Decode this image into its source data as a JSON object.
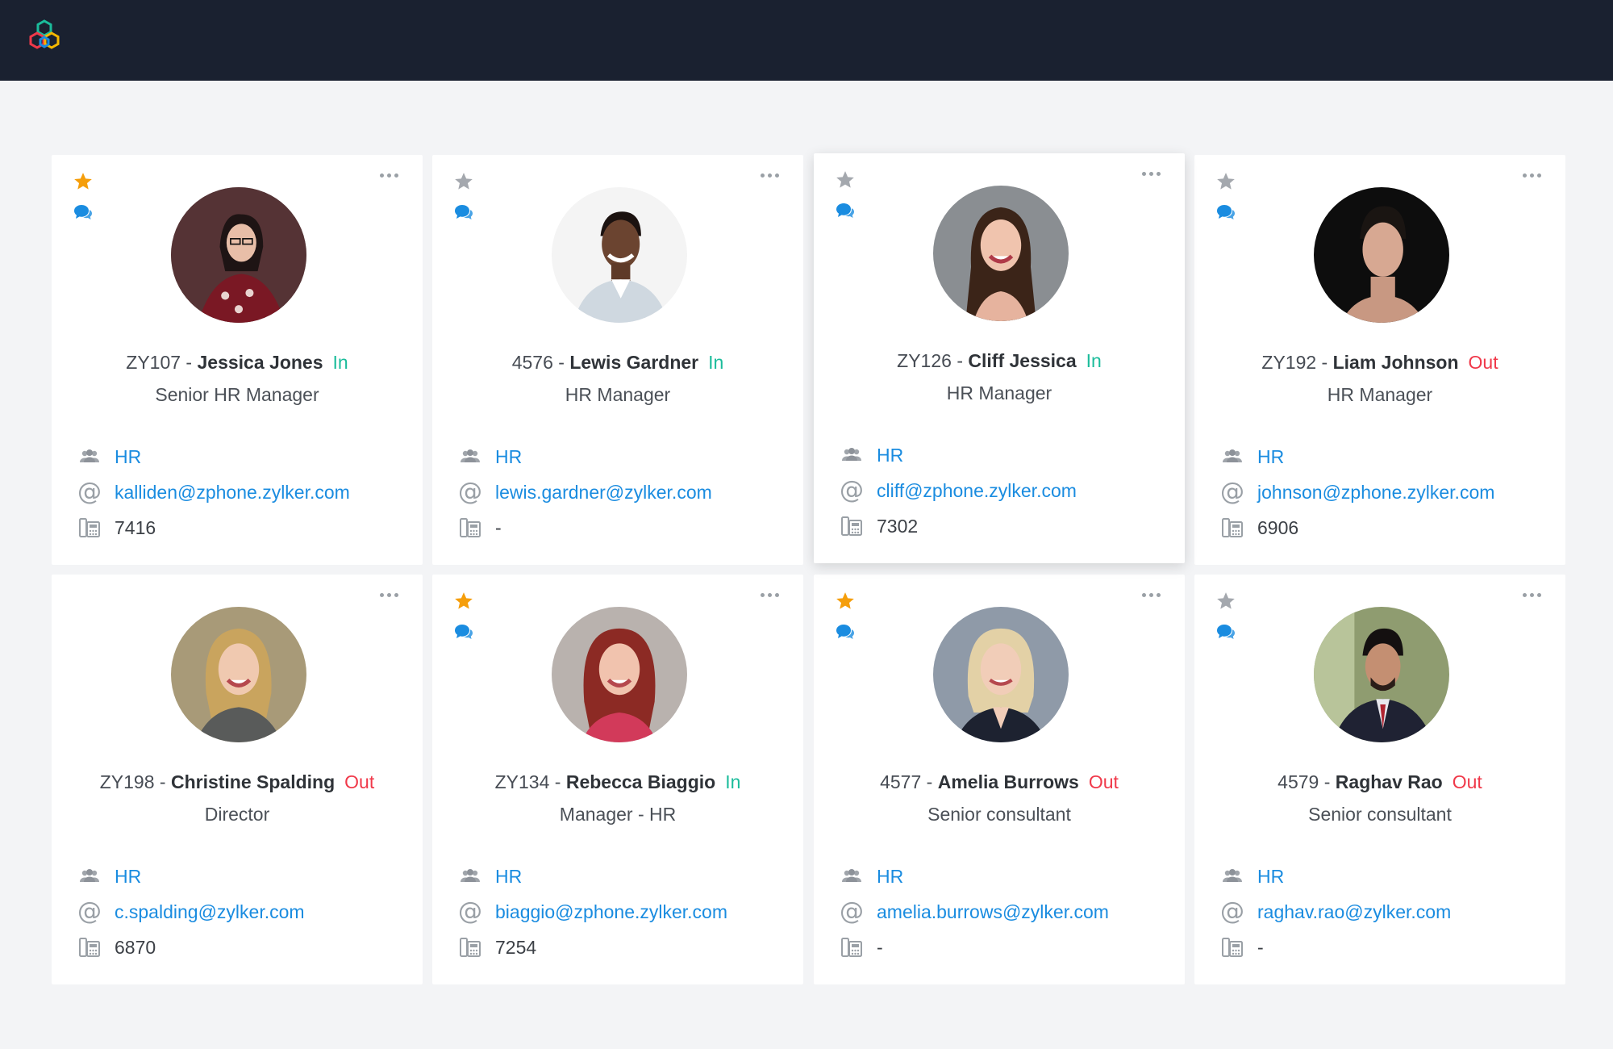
{
  "app": {
    "brand_colors": [
      "#1bbc9b",
      "#1a8ce0",
      "#f0394a",
      "#f5b800"
    ]
  },
  "colors": {
    "status_in": "#1bbc9b",
    "status_out": "#f0394a",
    "link": "#1a8ce0",
    "star_active": "#f59e0b",
    "star_inactive": "#a4a8ae"
  },
  "cards": [
    {
      "id": "ZY107",
      "separator": " - ",
      "name": "Jessica Jones",
      "status": "In",
      "role": "Senior HR Manager",
      "department": "HR",
      "email": "kalliden@zphone.zylker.com",
      "extension": "7416",
      "favorite": true,
      "chat": true
    },
    {
      "id": "4576",
      "separator": " - ",
      "name": "Lewis Gardner",
      "status": "In",
      "role": "HR Manager",
      "department": "HR",
      "email": "lewis.gardner@zylker.com",
      "extension": "-",
      "favorite": false,
      "chat": true
    },
    {
      "id": "ZY126",
      "separator": " - ",
      "name": "Cliff Jessica",
      "status": "In",
      "role": "HR Manager",
      "department": "HR",
      "email": "cliff@zphone.zylker.com",
      "extension": "7302",
      "favorite": false,
      "chat": true
    },
    {
      "id": "ZY192",
      "separator": " - ",
      "name": "Liam Johnson",
      "status": "Out",
      "role": "HR Manager",
      "department": "HR",
      "email": "johnson@zphone.zylker.com",
      "extension": "6906",
      "favorite": false,
      "chat": true
    },
    {
      "id": "ZY198",
      "separator": " - ",
      "name": "Christine Spalding",
      "status": "Out",
      "role": "Director",
      "department": "HR",
      "email": "c.spalding@zylker.com",
      "extension": "6870",
      "favorite": false,
      "chat": false
    },
    {
      "id": "ZY134",
      "separator": " - ",
      "name": "Rebecca Biaggio",
      "status": "In",
      "role": "Manager - HR",
      "department": "HR",
      "email": "biaggio@zphone.zylker.com",
      "extension": "7254",
      "favorite": true,
      "chat": true
    },
    {
      "id": "4577",
      "separator": " - ",
      "name": "Amelia Burrows",
      "status": "Out",
      "role": "Senior consultant",
      "department": "HR",
      "email": "amelia.burrows@zylker.com",
      "extension": "-",
      "favorite": true,
      "chat": true
    },
    {
      "id": "4579",
      "separator": " - ",
      "name": "Raghav Rao",
      "status": "Out",
      "role": "Senior consultant",
      "department": "HR",
      "email": "raghav.rao@zylker.com",
      "extension": "-",
      "favorite": false,
      "chat": true
    }
  ]
}
